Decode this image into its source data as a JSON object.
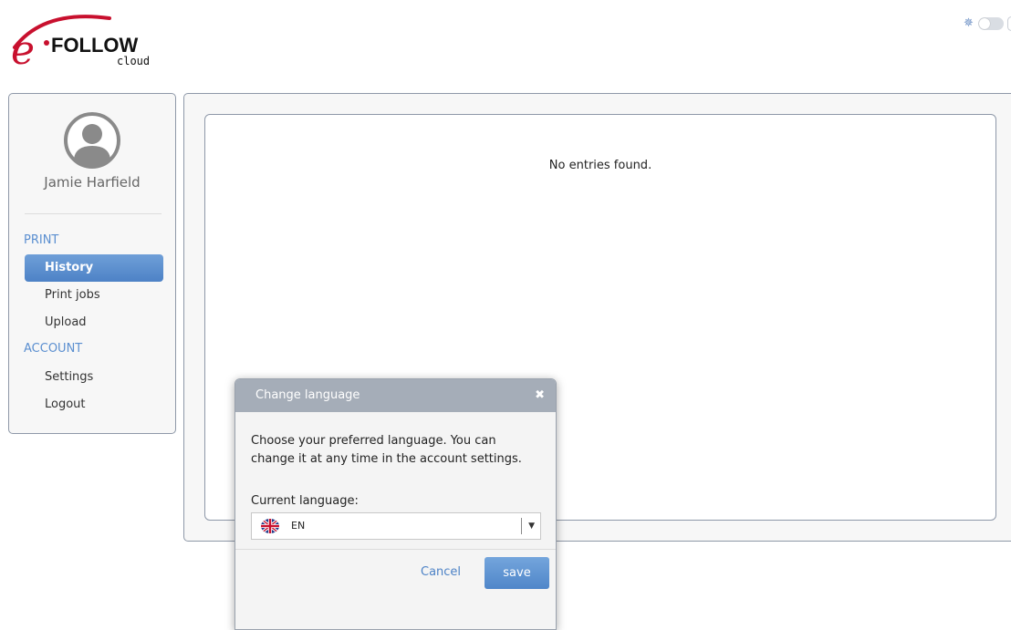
{
  "brand": {
    "logo_letter": "e",
    "logo_word": "FOLLOW",
    "logo_sub": "cloud",
    "accent_color": "#c8102e"
  },
  "user": {
    "name": "Jamie Harfield"
  },
  "sidebar": {
    "sections": [
      {
        "title": "PRINT",
        "items": [
          {
            "label": "History",
            "active": true
          },
          {
            "label": "Print jobs",
            "active": false
          },
          {
            "label": "Upload",
            "active": false
          }
        ]
      },
      {
        "title": "ACCOUNT",
        "items": [
          {
            "label": "Settings",
            "active": false
          },
          {
            "label": "Logout",
            "active": false
          }
        ]
      }
    ]
  },
  "main": {
    "empty_message": "No entries found."
  },
  "theme_toggle": {
    "icon": "sun-icon",
    "state": "off"
  },
  "modal": {
    "title": "Change language",
    "description": "Choose your preferred language. You can change it at any time in the account settings.",
    "language_label": "Current language:",
    "selected_language": "EN",
    "flag_icon": "uk-flag-icon",
    "cancel_label": "Cancel",
    "save_label": "save"
  }
}
